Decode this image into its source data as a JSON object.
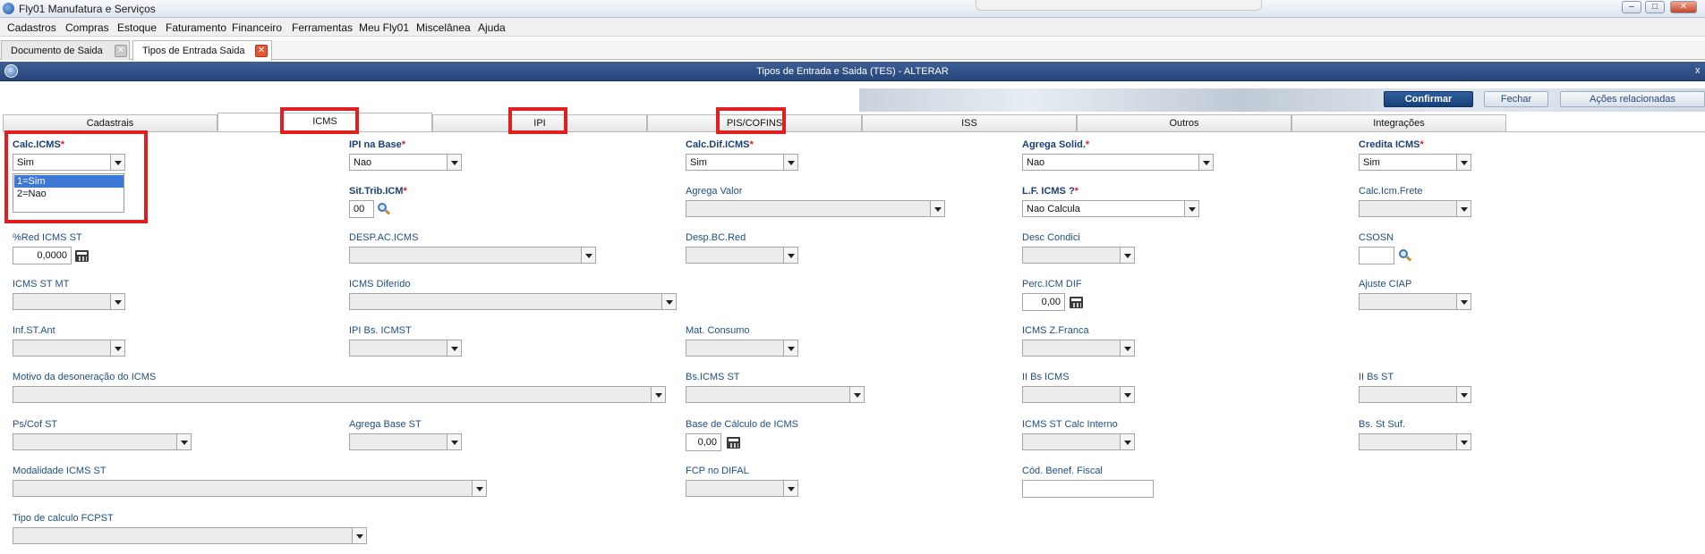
{
  "window": {
    "title": "Fly01 Manufatura e Serviços",
    "minimize": "–",
    "maximize": "□",
    "close": "✕"
  },
  "menu": [
    "Cadastros",
    "Compras",
    "Estoque",
    "Faturamento",
    "Financeiro",
    "Ferramentas",
    "Meu Fly01",
    "Miscelânea",
    "Ajuda"
  ],
  "doc_tabs": [
    {
      "label": "Documento de Saida",
      "close": "✕"
    },
    {
      "label": "Tipos de Entrada Saida",
      "close": "✕"
    }
  ],
  "dialog": {
    "title": "Tipos de Entrada e Saida (TES) - ALTERAR",
    "close": "x"
  },
  "actions": {
    "confirm": "Confirmar",
    "close": "Fechar",
    "related": "Ações relacionadas"
  },
  "tabs": [
    "Cadastrais",
    "ICMS",
    "IPI",
    "PIS/COFINS",
    "ISS",
    "Outros",
    "Integrações"
  ],
  "active_tab": "ICMS",
  "required_mark": "*",
  "fields": {
    "calc_icms": {
      "label": "Calc.ICMS",
      "value": "Sim"
    },
    "ipi_na_base": {
      "label": "IPI na Base",
      "value": "Nao"
    },
    "calc_dif_icms": {
      "label": "Calc.Dif.ICMS",
      "value": "Sim"
    },
    "agrega_solid": {
      "label": "Agrega Solid.",
      "value": "Nao"
    },
    "credita_icms": {
      "label": "Credita ICMS",
      "value": "Sim"
    },
    "sit_trib_icm": {
      "label": "Sit.Trib.ICM",
      "value": "00"
    },
    "agrega_valor": {
      "label": "Agrega Valor",
      "value": ""
    },
    "lf_icms": {
      "label": "L.F. ICMS ?",
      "value": "Nao Calcula"
    },
    "calc_icm_frete": {
      "label": "Calc.Icm.Frete",
      "value": ""
    },
    "red_icms_st": {
      "label": "%Red ICMS ST",
      "value": "0,0000"
    },
    "desp_ac_icms": {
      "label": "DESP.AC.ICMS",
      "value": ""
    },
    "desp_bc_red": {
      "label": "Desp.BC.Red",
      "value": ""
    },
    "desc_condici": {
      "label": "Desc Condici",
      "value": ""
    },
    "csosn": {
      "label": "CSOSN",
      "value": ""
    },
    "icms_st_mt": {
      "label": "ICMS ST MT",
      "value": ""
    },
    "icms_diferido": {
      "label": "ICMS Diferido",
      "value": ""
    },
    "perc_icm_dif": {
      "label": "Perc.ICM DIF",
      "value": "0,00"
    },
    "ajuste_ciap": {
      "label": "Ajuste CIAP",
      "value": ""
    },
    "inf_st_ant": {
      "label": "Inf.ST.Ant",
      "value": ""
    },
    "ipi_bs_icmst": {
      "label": "IPI Bs. ICMST",
      "value": ""
    },
    "mat_consumo": {
      "label": "Mat. Consumo",
      "value": ""
    },
    "icms_z_franca": {
      "label": "ICMS Z.Franca",
      "value": ""
    },
    "motivo_desoneracao": {
      "label": "Motivo da desoneração do ICMS",
      "value": ""
    },
    "bs_icms_st": {
      "label": "Bs.ICMS ST",
      "value": ""
    },
    "ii_bs_icms": {
      "label": "II Bs ICMS",
      "value": ""
    },
    "ii_bs_st": {
      "label": "II Bs ST",
      "value": ""
    },
    "ps_cof_st": {
      "label": "Ps/Cof ST",
      "value": ""
    },
    "agrega_base_st": {
      "label": "Agrega Base ST",
      "value": ""
    },
    "base_calculo_icms": {
      "label": "Base de Cálculo de ICMS",
      "value": "0,00"
    },
    "icms_st_calc_interno": {
      "label": "ICMS ST Calc Interno",
      "value": ""
    },
    "bs_st_suf": {
      "label": "Bs. St Suf.",
      "value": ""
    },
    "modalidade_icms_st": {
      "label": "Modalidade ICMS ST",
      "value": ""
    },
    "fcp_no_difal": {
      "label": "FCP no DIFAL",
      "value": ""
    },
    "cod_benef_fiscal": {
      "label": "Cód. Benef. Fiscal",
      "value": ""
    },
    "tipo_calculo_fcpst": {
      "label": "Tipo de calculo FCPST",
      "value": ""
    }
  },
  "calc_icms_options": [
    "1=Sim",
    "2=Nao"
  ],
  "calc_icms_selected": "1=Sim",
  "highlight_color": "#e02020",
  "icons": {
    "search": "magnifier-icon",
    "calculator": "calculator-icon"
  }
}
